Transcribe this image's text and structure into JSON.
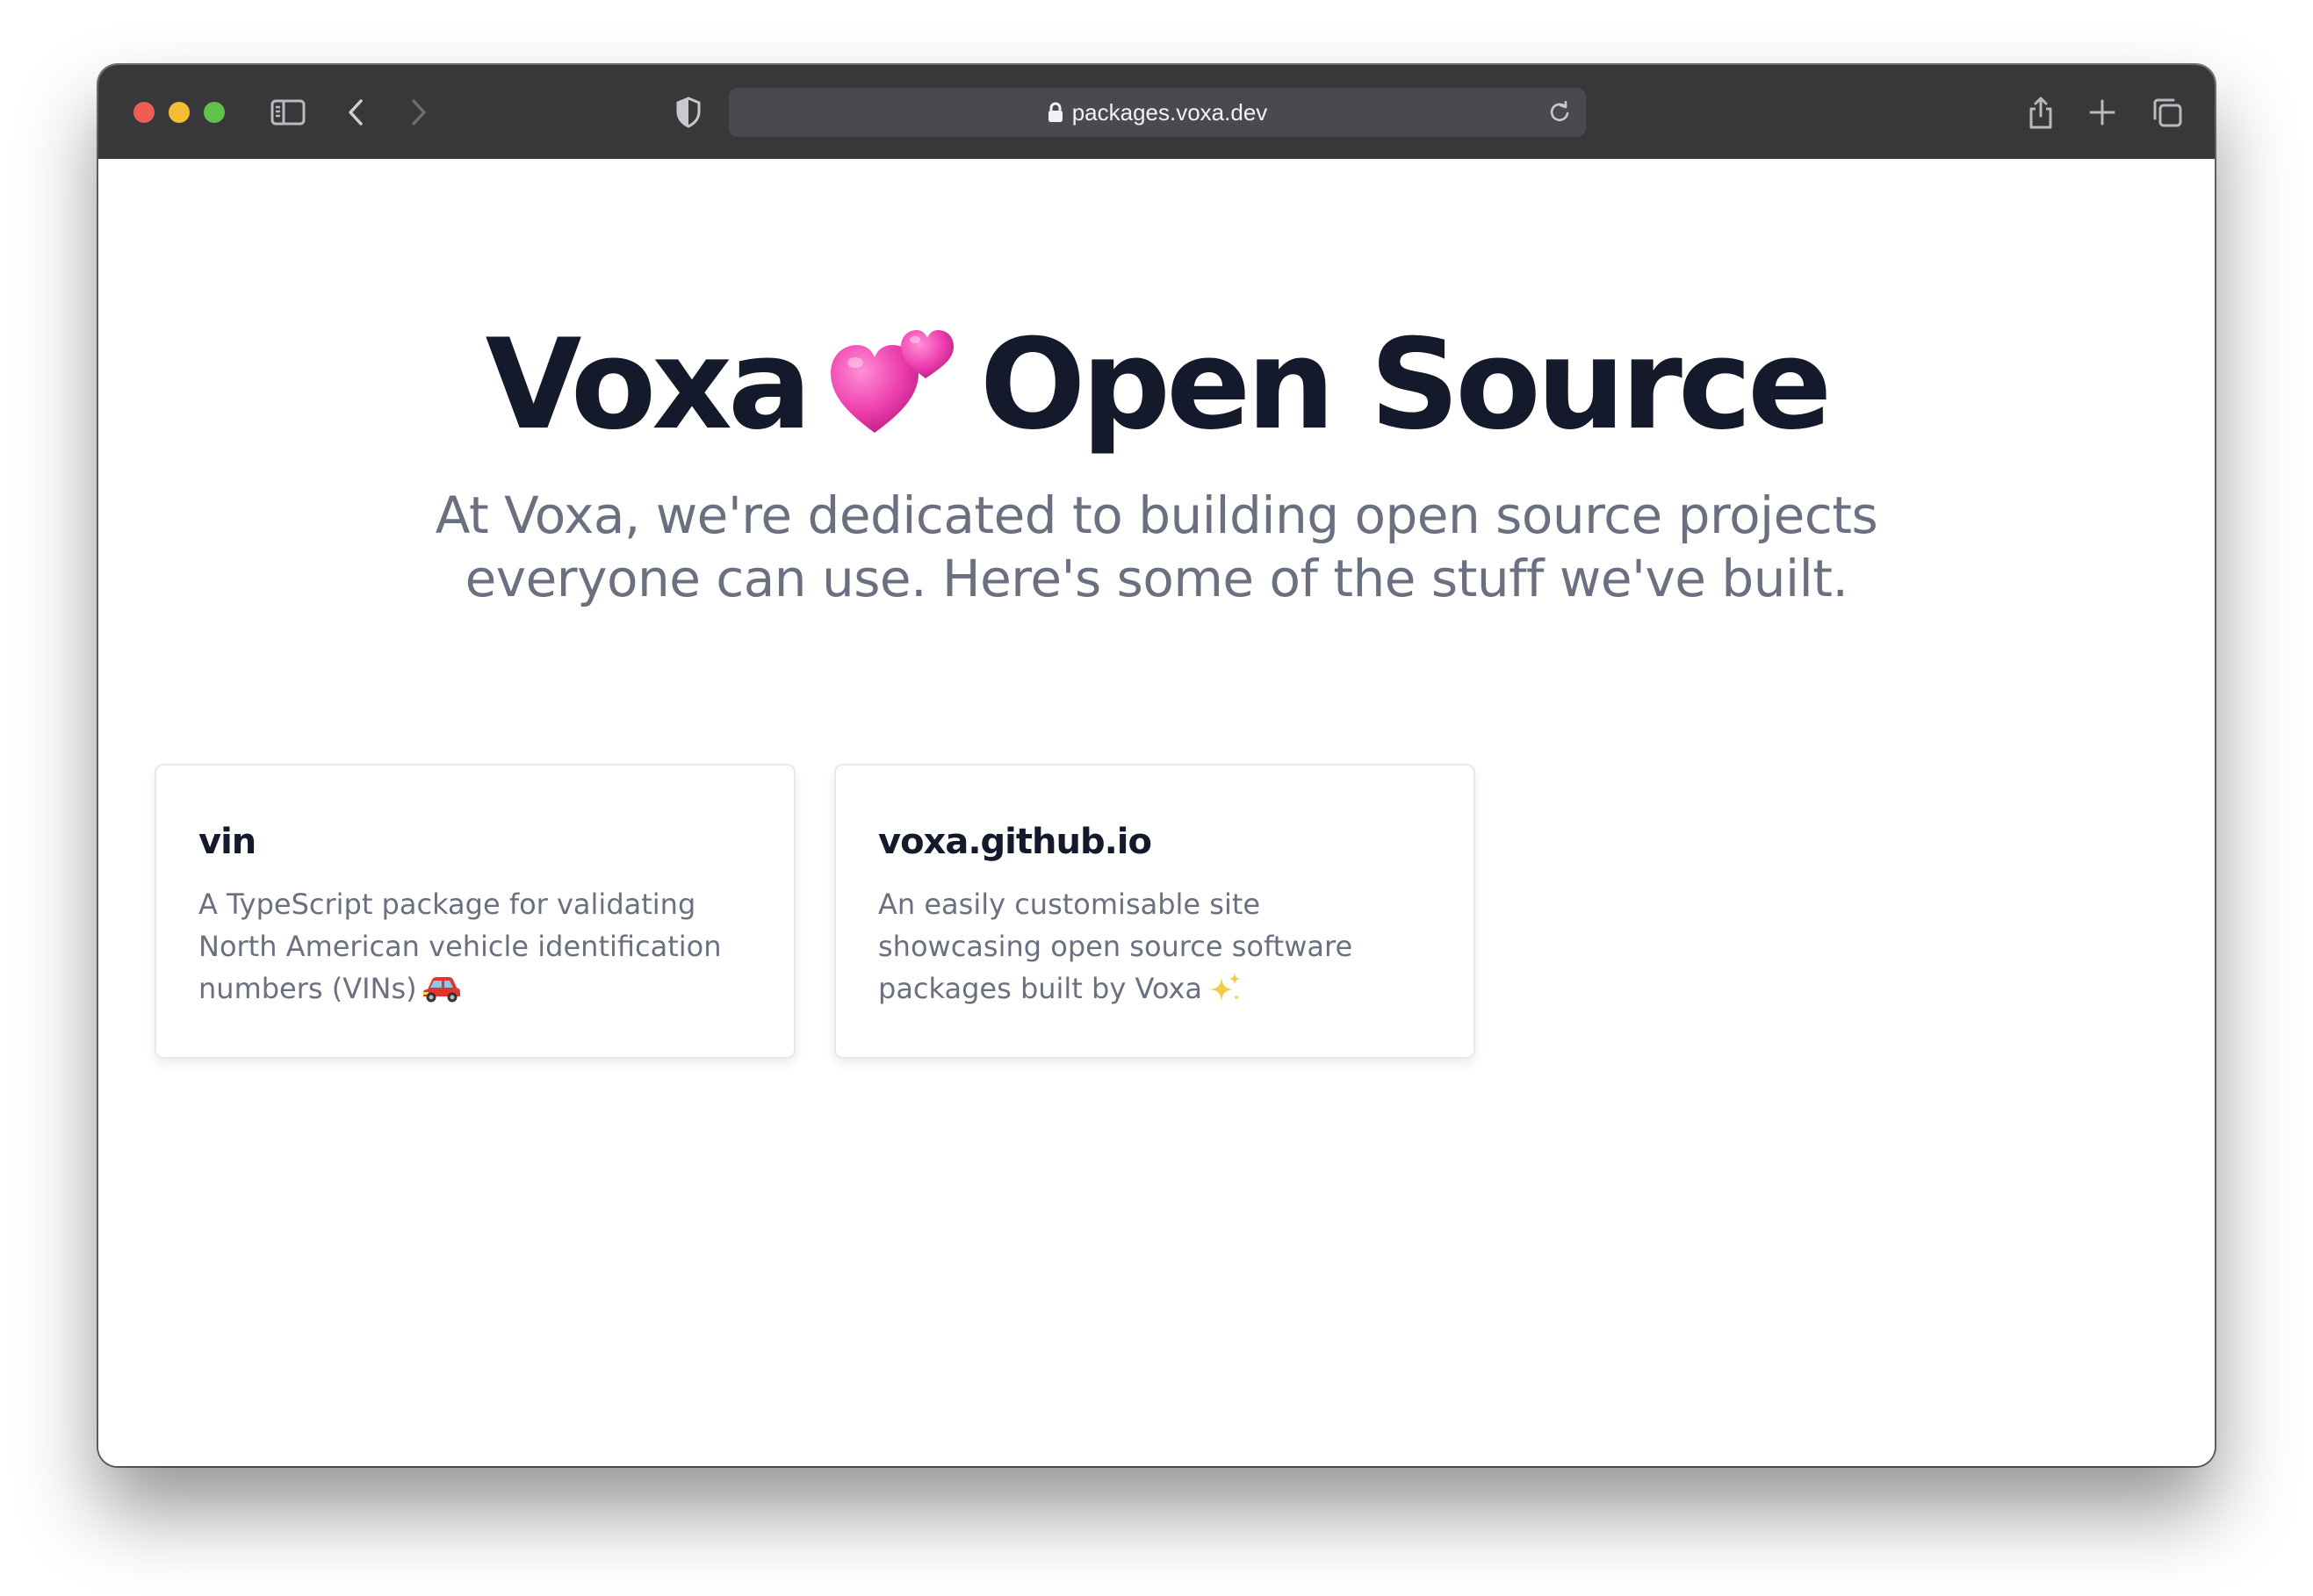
{
  "browser": {
    "url": "packages.voxa.dev",
    "icons": {
      "sidebar": "sidebar-toggle-icon",
      "back": "chevron-left-icon",
      "forward": "chevron-right-icon",
      "privacy": "shield-icon",
      "lock": "lock-icon",
      "reload": "reload-icon",
      "share": "share-icon",
      "new_tab": "plus-icon",
      "tabs": "tab-overview-icon"
    }
  },
  "hero": {
    "title_left": "Voxa",
    "title_emoji": "💕",
    "title_right": "Open Source",
    "subtitle": "At Voxa, we're dedicated to building open source projects everyone can use. Here's some of the stuff we've built."
  },
  "projects": [
    {
      "name": "vin",
      "description": "A TypeScript package for validating North American vehicle identification numbers (VINs)",
      "emoji": "🚗"
    },
    {
      "name": "voxa.github.io",
      "description": "An easily customisable site showcasing open source software packages built by Voxa",
      "emoji": "✨"
    }
  ],
  "colors": {
    "titlebar": "#38383b",
    "heading": "#141a2b",
    "body_text": "#6b7080"
  }
}
